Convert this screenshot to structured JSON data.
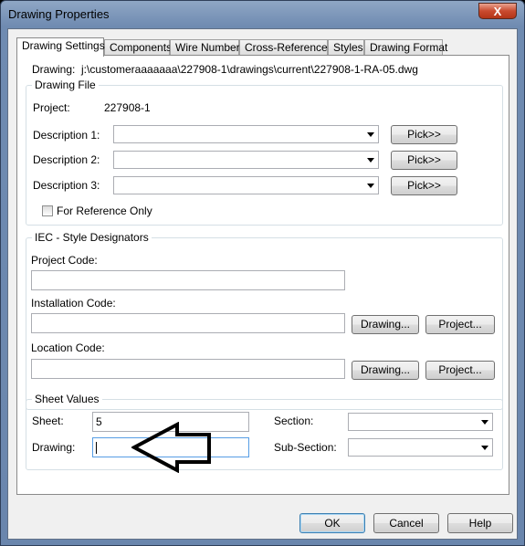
{
  "window": {
    "title": "Drawing Properties",
    "close_glyph": "X"
  },
  "tabs": [
    "Drawing Settings",
    "Components",
    "Wire Numbers",
    "Cross-References",
    "Styles",
    "Drawing Format"
  ],
  "drawing": {
    "label": "Drawing:",
    "path": "j:\\customeraaaaaaa\\227908-1\\drawings\\current\\227908-1-RA-05.dwg"
  },
  "drawing_file": {
    "title": "Drawing File",
    "project_label": "Project:",
    "project_value": "227908-1",
    "desc1_label": "Description 1:",
    "desc2_label": "Description 2:",
    "desc3_label": "Description 3:",
    "desc1_value": "",
    "desc2_value": "",
    "desc3_value": "",
    "pick_label": "Pick>>",
    "ref_only_label": "For Reference Only",
    "ref_only_checked": false
  },
  "iec": {
    "title": "IEC - Style Designators",
    "project_code_label": "Project Code:",
    "project_code_value": "",
    "installation_code_label": "Installation Code:",
    "installation_code_value": "",
    "location_code_label": "Location Code:",
    "location_code_value": "",
    "drawing_btn": "Drawing...",
    "project_btn": "Project..."
  },
  "sheet_values": {
    "title": "Sheet Values",
    "sheet_label": "Sheet:",
    "sheet_value": "5",
    "drawing_label": "Drawing:",
    "drawing_value": "",
    "section_label": "Section:",
    "section_value": "",
    "subsection_label": "Sub-Section:",
    "subsection_value": ""
  },
  "footer": {
    "ok": "OK",
    "cancel": "Cancel",
    "help": "Help"
  },
  "annotation": {
    "arrow_icon": "hollow-left-arrow",
    "arrow_color": "#000000"
  }
}
